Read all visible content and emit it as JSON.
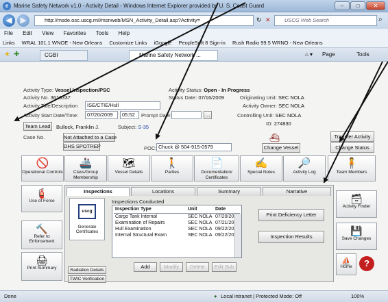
{
  "window": {
    "title": "Marine Safety Network v1.0 - Activity Detail - Windows Internet Explorer provided by U. S. Coast Guard",
    "controls": [
      "–",
      "□",
      "✕"
    ]
  },
  "address": {
    "url": "http://msde.osc.uscg.mil/msnweb/MSN_Activity_Detail.asp?Activity=",
    "search_placeholder": "USCG Web Search"
  },
  "menu": [
    "File",
    "Edit",
    "View",
    "Favorites",
    "Tools",
    "Help"
  ],
  "links": [
    "Links",
    "WRAL 101.1 WNOE - New Orleans",
    "Customize Links",
    "iGoogle",
    "PeopleSoft 8 Sign-in",
    "Rush Radio 99.5 WRNO - New Orleans"
  ],
  "tabs": {
    "tab1": "CGBI",
    "tab2": "Marine Safety Network ...",
    "page": "Page",
    "tools": "Tools"
  },
  "activity": {
    "type_label": "Activity Type:",
    "type_value": "Vessel Inspection/PSC",
    "no_label": "Activity No.",
    "no_value": "3616337",
    "title_label": "Activity Title/Description",
    "title_value": "ISE/CTIE/Hull",
    "start_label": "Activity Start Date/Time:",
    "start_date": "07/20/2009",
    "start_time": "05:52",
    "prompt_label": "Prompt Date:",
    "team_lead_button": "Team Lead",
    "team_lead_value": "Bullock, Franklin J.",
    "subject_label": "Subject:",
    "subject_value": "S-35",
    "status_label": "Activity Status:",
    "status_value": "Open - In Progress",
    "status_date_label": "Status Date:",
    "status_date_value": "07/16/2009",
    "originating_label": "Originating Unit:",
    "originating_value": "SEC NOLA",
    "owner_label": "Activity Owner:",
    "owner_value": "SEC NOLA",
    "controlling_label": "Controlling Unit:",
    "controlling_value": "SEC NOLA",
    "id_label": "ID:",
    "id_value": "274830",
    "case_label": "Case No.",
    "case_button": "Not Attached to a Case",
    "dhs_button": "DHS SPOTREP",
    "poc_label": "POC:",
    "poc_value": "Chuck @ 504-915-0579",
    "transfer_button": "Transfer Activity",
    "change_status_button": "Change Status",
    "change_vessel_button": "Change Vessel"
  },
  "toolbar": [
    {
      "icon": "🚫",
      "label": "Operational Controls"
    },
    {
      "icon": "🚢",
      "label": "Class/Group Membership"
    },
    {
      "icon": "🗺",
      "label": "Vessel Details"
    },
    {
      "icon": "🚶",
      "label": "Parties"
    },
    {
      "icon": "📄",
      "label": "Documentation/ Certificates"
    },
    {
      "icon": "✍",
      "label": "Special Notes"
    },
    {
      "icon": "🔎",
      "label": "Activity Log"
    },
    {
      "icon": "🧍",
      "label": "Team Members"
    }
  ],
  "left_side": [
    {
      "icon": "🧯",
      "label": "Use of Force"
    },
    {
      "icon": "🔨",
      "label": "Refer to Enforcement"
    },
    {
      "icon": "🖨",
      "label": "Print Summary"
    }
  ],
  "right_side": [
    {
      "icon": "🗃",
      "label": "Activity Finder"
    },
    {
      "icon": "💾",
      "label": "Save Changes"
    },
    {
      "icon": "⛵",
      "label": "Home"
    },
    {
      "icon": "?",
      "label": ""
    }
  ],
  "subtabs": [
    "Inspections",
    "Locations",
    "Summary",
    "Narrative"
  ],
  "inspections": {
    "conducted_label": "Inspections Conducted",
    "columns": [
      "Inspection Type",
      "Unit",
      "Date"
    ],
    "rows": [
      [
        "Cargo Tank Internal",
        "SEC NOLA",
        "07/20/20..."
      ],
      [
        "Examination of Repairs",
        "SEC NOLA",
        "07/21/20..."
      ],
      [
        "Hull Examination",
        "SEC NOLA",
        "09/22/20..."
      ],
      [
        "Internal Structural Exam",
        "SEC NOLA",
        "09/22/20..."
      ]
    ],
    "generate_label": "Generate Certificates",
    "uscg_label": "uscg",
    "radiation_button": "Radiation Details",
    "twic_button": "TWIC Verification",
    "add_button": "Add",
    "modify_button": "Modify",
    "delete_button": "Delete",
    "edit_button": "Edit Sub",
    "print_def_button": "Print Deficiency Letter",
    "results_button": "Inspection Results"
  },
  "status": {
    "left": "Done",
    "zone": "Local intranet | Protected Mode: Off",
    "zoom": "100%"
  }
}
